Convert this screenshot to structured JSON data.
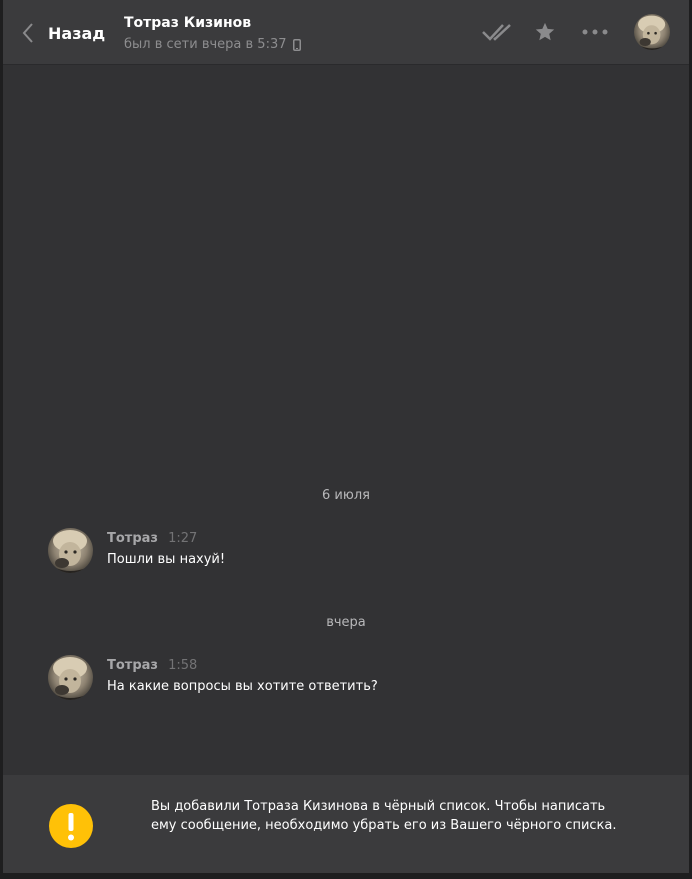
{
  "header": {
    "back_label": "Назад",
    "peer_name": "Тотраз Кизинов",
    "peer_status": "был в сети вчера в 5:37",
    "icons": [
      "chevron-left-icon",
      "mobile-phone-icon",
      "double-check-icon",
      "star-icon",
      "more-dots-icon"
    ]
  },
  "chat": {
    "date_1": "6 июля",
    "date_2": "вчера",
    "messages": [
      {
        "author": "Тотраз",
        "time": "1:27",
        "text": "Пошли вы нахуй!"
      },
      {
        "author": "Тотраз",
        "time": "1:58",
        "text": "На какие вопросы вы хотите ответить?"
      }
    ]
  },
  "footer": {
    "notice": "Вы добавили Тотраза Кизинова в чёрный список. Чтобы написать ему сообщение, необходимо убрать его из Вашего чёрного списка.",
    "icon": "warning-icon",
    "accent": "#ffc107"
  },
  "colors": {
    "background": "#323234",
    "header": "#3b3b3d",
    "text": "#ffffff",
    "muted": "#8d8d8f"
  }
}
